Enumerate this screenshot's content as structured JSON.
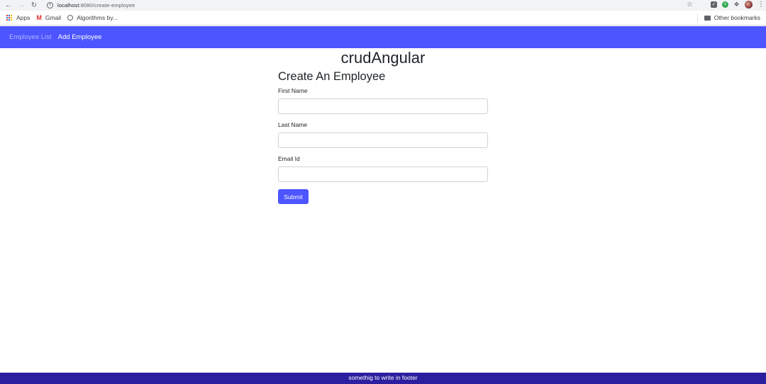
{
  "browser": {
    "url_host": "localhost",
    "url_rest": ":8080/create-employee",
    "bookmarks": [
      {
        "label": "Apps"
      },
      {
        "label": "Gmail"
      },
      {
        "label": "Algorithms by..."
      }
    ],
    "other_bookmarks": "Other bookmarks"
  },
  "navbar": {
    "links": [
      {
        "label": "Employee List"
      },
      {
        "label": "Add Employee"
      }
    ],
    "color": "#4c55ff"
  },
  "app": {
    "title": "crudAngular"
  },
  "form": {
    "heading": "Create An Employee",
    "fields": [
      {
        "label": "First Name",
        "value": "",
        "placeholder": ""
      },
      {
        "label": "Last Name",
        "value": "",
        "placeholder": ""
      },
      {
        "label": "Email Id",
        "value": "",
        "placeholder": ""
      }
    ],
    "submit_label": "Submit"
  },
  "footer": {
    "text": "somethig to write in footer",
    "color": "#2b1fa0"
  }
}
